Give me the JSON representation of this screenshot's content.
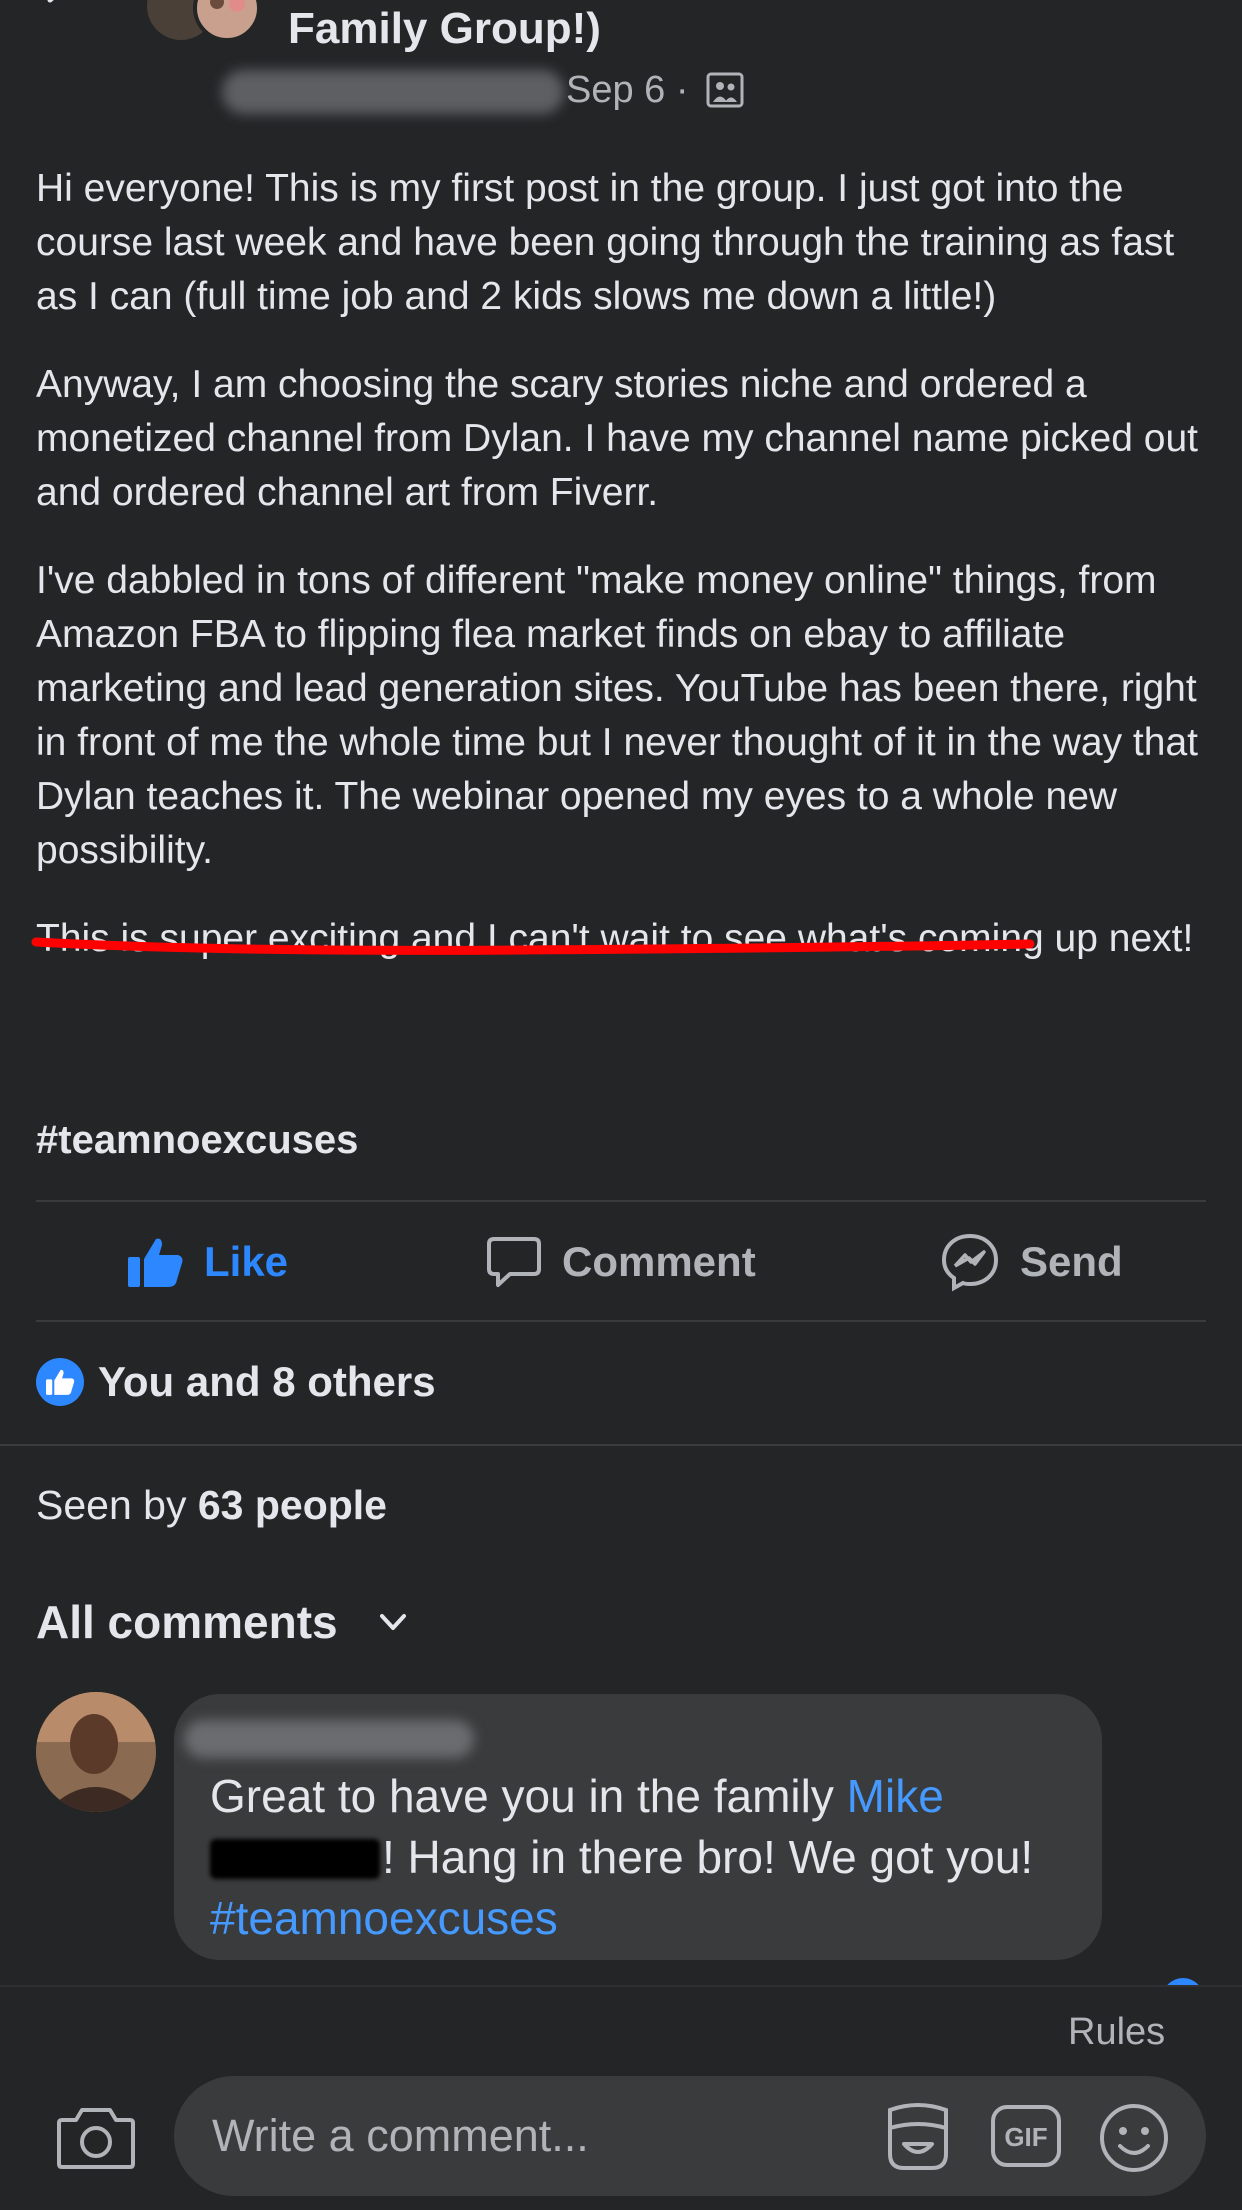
{
  "header": {
    "group_title": "Family Group!)",
    "date": "Sep 6 ·"
  },
  "post": {
    "paragraphs": [
      "Hi everyone! This is my first post in the group. I just got into the course last week and have been going through the training as fast as I can (full time job and 2 kids slows me down a little!)",
      "Anyway, I am choosing the scary stories niche and ordered a monetized channel from Dylan. I have my channel name picked out and ordered channel art from Fiverr.",
      "I've dabbled in tons of different \"make money online\" things, from Amazon FBA to flipping flea market finds on ebay to affiliate marketing and lead generation sites. YouTube has been there, right in front of me the whole time but I never thought of it in the way that Dylan teaches it. The webinar opened my eyes to a whole new possibility.",
      "This is super exciting and I can't wait to see what's coming up next!"
    ],
    "hashtag": "#teamnoexcuses"
  },
  "actions": {
    "like": "Like",
    "comment": "Comment",
    "send": "Send"
  },
  "reactions": {
    "summary": "You and 8 others"
  },
  "seen": {
    "prefix": "Seen by",
    "count": "63 people"
  },
  "comments": {
    "filter_label": "All comments",
    "items": [
      {
        "text_before": "Great to have you in the family ",
        "mention": "Mike",
        "text_after": "! Hang in there bro! We got you! ",
        "hashtag": "#teamnoexcuses"
      }
    ]
  },
  "composer": {
    "rules": "Rules",
    "placeholder": "Write a comment..."
  },
  "colors": {
    "background": "#242527",
    "accent": "#2d88ff",
    "bubble": "#3a3b3c",
    "annotation": "#ff0000"
  },
  "icons": [
    "back-chevron-icon",
    "group-icon",
    "like-icon",
    "comment-icon",
    "messenger-icon",
    "camera-icon",
    "avatar-sticker-icon",
    "gif-icon",
    "emoji-icon"
  ]
}
